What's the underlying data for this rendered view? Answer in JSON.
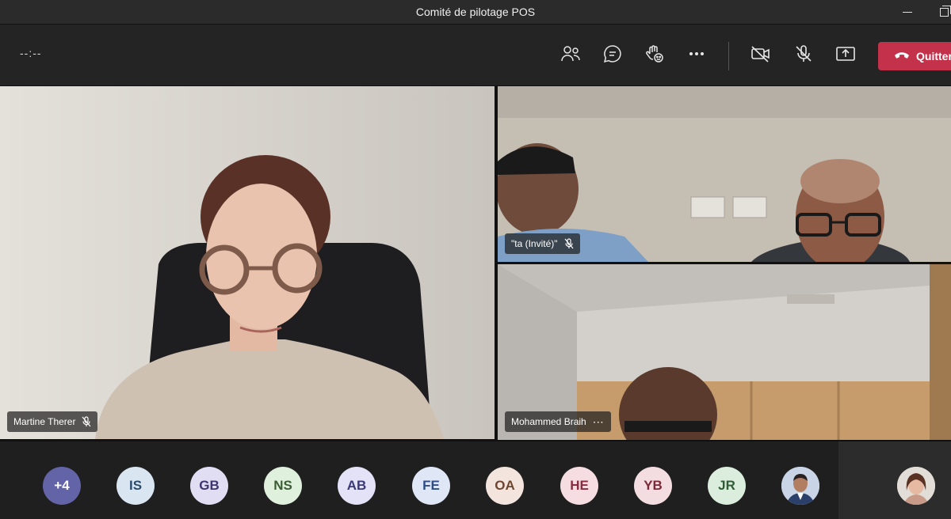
{
  "window": {
    "title": "Comité de pilotage POS"
  },
  "toolbar": {
    "timer": "--:--",
    "icons": [
      "participants-icon",
      "chat-icon",
      "reactions-icon",
      "more-icon",
      "camera-off-icon",
      "mic-off-icon",
      "share-screen-icon"
    ],
    "leave_label": "Quitter"
  },
  "tiles": {
    "main": {
      "name": "Martine Therer",
      "muted": true
    },
    "top_right": {
      "name": "\"ta (Invité)\"",
      "muted": true
    },
    "bottom_right": {
      "name": "Mohammed Braih",
      "more": "⋯"
    }
  },
  "roster": {
    "overflow": "+4",
    "participants": [
      {
        "initials": "IS",
        "bg": "#d9e6f2",
        "fg": "#2c4a6b"
      },
      {
        "initials": "GB",
        "bg": "#e1def3",
        "fg": "#3f3570"
      },
      {
        "initials": "NS",
        "bg": "#dff0dc",
        "fg": "#3a5c34"
      },
      {
        "initials": "AB",
        "bg": "#e3e2f7",
        "fg": "#3b3a78"
      },
      {
        "initials": "FE",
        "bg": "#dfe7f7",
        "fg": "#2f4c86"
      },
      {
        "initials": "OA",
        "bg": "#f3e5dd",
        "fg": "#6e4630"
      },
      {
        "initials": "HE",
        "bg": "#f6dde2",
        "fg": "#8a2d3f"
      },
      {
        "initials": "YB",
        "bg": "#f3dde1",
        "fg": "#7a2a38"
      },
      {
        "initials": "JR",
        "bg": "#dbeedd",
        "fg": "#2f5b36"
      }
    ]
  },
  "colors": {
    "accent_leave": "#c4314b",
    "overflow_avatar": "#6264a7"
  }
}
